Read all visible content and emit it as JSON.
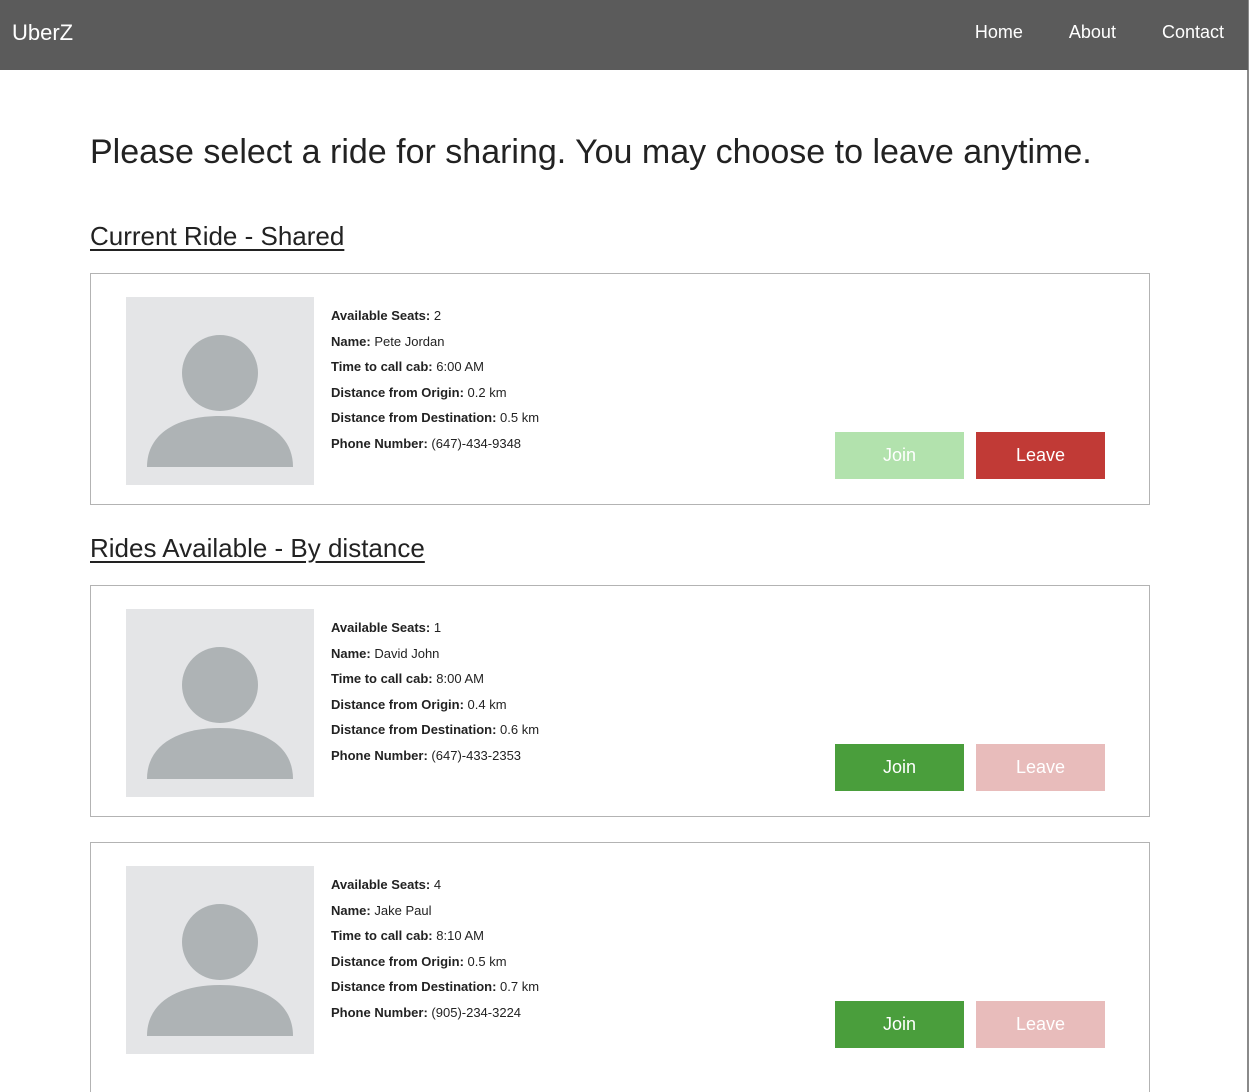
{
  "app": {
    "brand": "UberZ"
  },
  "nav": {
    "home": "Home",
    "about": "About",
    "contact": "Contact"
  },
  "headline": "Please select a ride for sharing. You may choose to leave anytime.",
  "sections": {
    "current": "Current Ride - Shared",
    "available": "Rides Available - By distance"
  },
  "labels": {
    "seats": "Available Seats:",
    "name": "Name:",
    "time": "Time to call cab:",
    "origin": "Distance from Origin:",
    "destination": "Distance from Destination:",
    "phone": "Phone Number:"
  },
  "buttons": {
    "join": "Join",
    "leave": "Leave"
  },
  "rides": [
    {
      "seats": "2",
      "name": "Pete Jordan",
      "time": "6:00 AM",
      "origin": "0.2 km",
      "destination": "0.5 km",
      "phone": "(647)-434-9348",
      "join_enabled": false,
      "leave_enabled": true
    },
    {
      "seats": "1",
      "name": "David John",
      "time": "8:00 AM",
      "origin": "0.4 km",
      "destination": "0.6 km",
      "phone": "(647)-433-2353",
      "join_enabled": true,
      "leave_enabled": false
    },
    {
      "seats": "4",
      "name": "Jake Paul",
      "time": "8:10 AM",
      "origin": "0.5 km",
      "destination": "0.7 km",
      "phone": "(905)-234-3224",
      "join_enabled": true,
      "leave_enabled": false
    }
  ],
  "colors": {
    "navbar": "#5b5b5b",
    "join": "#4a9e3c",
    "join_disabled": "#b2e2ad",
    "leave": "#c13a36",
    "leave_disabled": "#e8bcbb",
    "avatar_bg": "#e4e5e7",
    "avatar_fg": "#aeb3b5"
  },
  "icons": {
    "avatar": "user-silhouette-icon"
  }
}
